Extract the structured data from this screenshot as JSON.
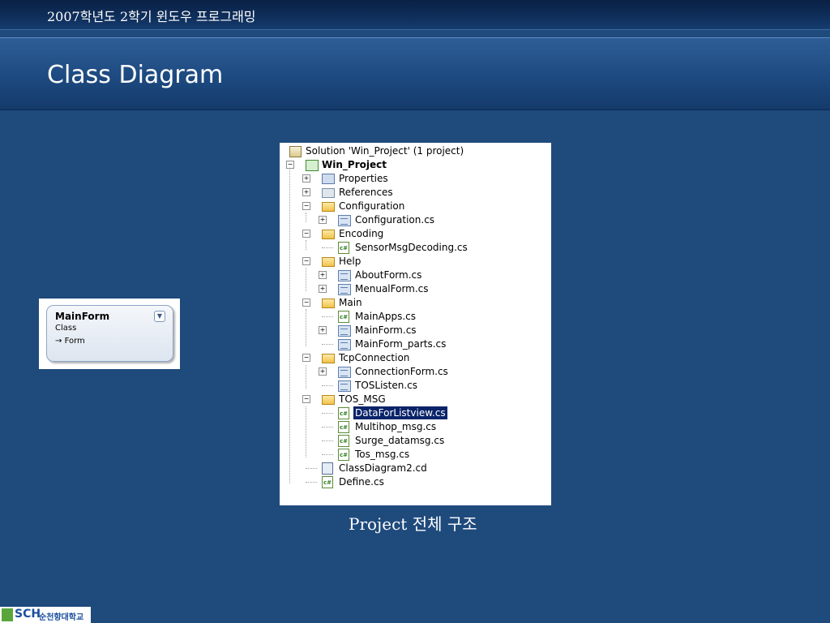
{
  "header": {
    "course_title": "2007학년도 2학기 윈도우 프로그래밍",
    "page_title": "Class Diagram"
  },
  "class_shape": {
    "name": "MainForm",
    "kind": "Class",
    "base": "Form",
    "base_arrow": "→"
  },
  "solution_tree": {
    "solution": "Solution 'Win_Project' (1 project)",
    "project": "Win_Project",
    "items": {
      "properties": "Properties",
      "references": "References",
      "configuration": "Configuration",
      "configuration_cs": "Configuration.cs",
      "encoding": "Encoding",
      "sensor_msg_decoding_cs": "SensorMsgDecoding.cs",
      "help": "Help",
      "about_form_cs": "AboutForm.cs",
      "menual_form_cs": "MenualForm.cs",
      "main": "Main",
      "main_apps_cs": "MainApps.cs",
      "main_form_cs": "MainForm.cs",
      "main_form_parts_cs": "MainForm_parts.cs",
      "tcp_connection": "TcpConnection",
      "connection_form_cs": "ConnectionForm.cs",
      "tos_listen_cs": "TOSListen.cs",
      "tos_msg": "TOS_MSG",
      "data_for_listview_cs": "DataForListview.cs",
      "multihop_msg_cs": "Multihop_msg.cs",
      "surge_datamsg_cs": "Surge_datamsg.cs",
      "tos_msg_cs": "Tos_msg.cs",
      "class_diagram_cd": "ClassDiagram2.cd",
      "define_cs": "Define.cs"
    },
    "selected_item": "DataForListview.cs"
  },
  "caption": "Project 전체 구조",
  "logo": {
    "mark": "SCH",
    "name": "순천향대학교"
  }
}
